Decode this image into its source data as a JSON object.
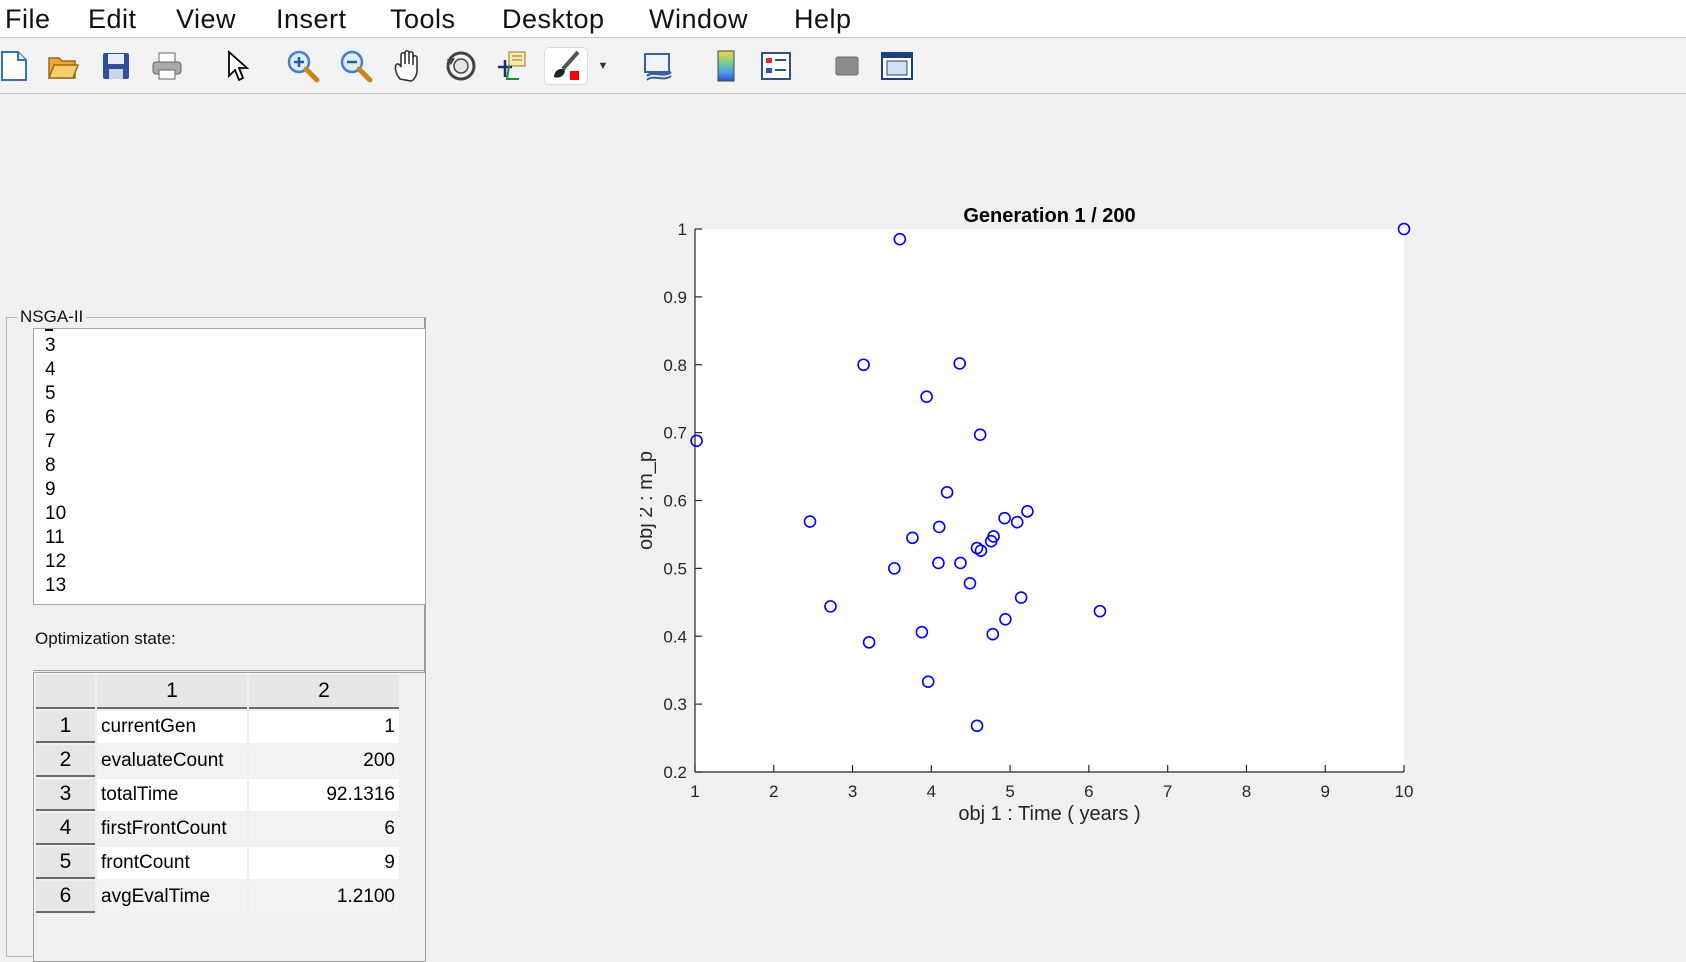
{
  "menubar": {
    "items": [
      "File",
      "Edit",
      "View",
      "Insert",
      "Tools",
      "Desktop",
      "Window",
      "Help"
    ]
  },
  "toolbar": {
    "buttons": [
      "new-figure-icon",
      "open-file-icon",
      "save-icon",
      "print-icon",
      "edit-plot-arrow-icon",
      "zoom-in-icon",
      "zoom-out-icon",
      "pan-hand-icon",
      "rotate-3d-icon",
      "data-cursor-icon",
      "brush-icon",
      "link-plot-icon",
      "colorbar-icon",
      "legend-icon",
      "hide-plot-tools-icon",
      "show-plot-tools-icon"
    ]
  },
  "panel": {
    "title": "NSGA-II",
    "list_items": [
      "3",
      "4",
      "5",
      "6",
      "7",
      "8",
      "9",
      "10",
      "11",
      "12",
      "13"
    ],
    "state_label": "Optimization state:",
    "table": {
      "columns": [
        "1",
        "2"
      ],
      "rows": [
        {
          "index": "1",
          "name": "currentGen",
          "value": "1"
        },
        {
          "index": "2",
          "name": "evaluateCount",
          "value": "200"
        },
        {
          "index": "3",
          "name": "totalTime",
          "value": "92.1316"
        },
        {
          "index": "4",
          "name": "firstFrontCount",
          "value": "6"
        },
        {
          "index": "5",
          "name": "frontCount",
          "value": "9"
        },
        {
          "index": "6",
          "name": "avgEvalTime",
          "value": "1.2100"
        }
      ]
    }
  },
  "chart_data": {
    "type": "scatter",
    "title": "Generation 1 / 200",
    "xlabel": "obj 1 : Time ( years )",
    "ylabel": "obj 2 : m_p",
    "xlim": [
      1,
      10
    ],
    "ylim": [
      0.2,
      1
    ],
    "xticks": [
      "1",
      "2",
      "3",
      "4",
      "5",
      "6",
      "7",
      "8",
      "9",
      "10"
    ],
    "yticks": [
      "0.2",
      "0.3",
      "0.4",
      "0.5",
      "0.6",
      "0.7",
      "0.8",
      "0.9",
      "1"
    ],
    "grid": false,
    "marker_color": "#0000ff",
    "points": [
      {
        "x": 3.6,
        "y": 0.985
      },
      {
        "x": 10.0,
        "y": 1.0
      },
      {
        "x": 3.14,
        "y": 0.8
      },
      {
        "x": 4.36,
        "y": 0.802
      },
      {
        "x": 3.94,
        "y": 0.753
      },
      {
        "x": 1.02,
        "y": 0.688
      },
      {
        "x": 4.62,
        "y": 0.697
      },
      {
        "x": 4.2,
        "y": 0.612
      },
      {
        "x": 2.46,
        "y": 0.569
      },
      {
        "x": 5.22,
        "y": 0.584
      },
      {
        "x": 4.93,
        "y": 0.574
      },
      {
        "x": 5.09,
        "y": 0.568
      },
      {
        "x": 4.1,
        "y": 0.561
      },
      {
        "x": 3.76,
        "y": 0.545
      },
      {
        "x": 4.79,
        "y": 0.547
      },
      {
        "x": 4.76,
        "y": 0.54
      },
      {
        "x": 4.58,
        "y": 0.53
      },
      {
        "x": 4.63,
        "y": 0.526
      },
      {
        "x": 4.09,
        "y": 0.508
      },
      {
        "x": 4.37,
        "y": 0.508
      },
      {
        "x": 3.53,
        "y": 0.5
      },
      {
        "x": 4.49,
        "y": 0.478
      },
      {
        "x": 5.14,
        "y": 0.457
      },
      {
        "x": 2.72,
        "y": 0.444
      },
      {
        "x": 6.14,
        "y": 0.437
      },
      {
        "x": 4.94,
        "y": 0.425
      },
      {
        "x": 3.88,
        "y": 0.406
      },
      {
        "x": 4.78,
        "y": 0.403
      },
      {
        "x": 3.21,
        "y": 0.391
      },
      {
        "x": 3.96,
        "y": 0.333
      },
      {
        "x": 4.58,
        "y": 0.268
      }
    ]
  }
}
